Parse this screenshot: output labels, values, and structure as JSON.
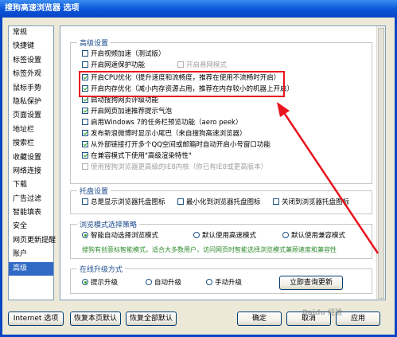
{
  "window": {
    "title": "搜狗高速浏览器 选项"
  },
  "sidebar": {
    "items": [
      {
        "label": "常规"
      },
      {
        "label": "快捷键"
      },
      {
        "label": "标签设置"
      },
      {
        "label": "标签外观"
      },
      {
        "label": "鼠标手势"
      },
      {
        "label": "隐私保护"
      },
      {
        "label": "页面设置"
      },
      {
        "label": "地址栏"
      },
      {
        "label": "搜索栏"
      },
      {
        "label": "收藏设置"
      },
      {
        "label": "网络连接"
      },
      {
        "label": "下载"
      },
      {
        "label": "广告过滤"
      },
      {
        "label": "智能填表"
      },
      {
        "label": "安全"
      },
      {
        "label": "网页更新提醒"
      },
      {
        "label": "账户"
      },
      {
        "label": "高级"
      }
    ],
    "selected": "高级"
  },
  "advanced": {
    "title": "高级设置",
    "options": [
      {
        "label": "开启视频加速（测试版）",
        "checked": false
      },
      {
        "label": "开启网速保护功能",
        "checked": false
      },
      {
        "label": "开启CPU优化（提升速度和流畅度，推荐在使用不流畅时开启）",
        "checked": true
      },
      {
        "label": "开启内存优化（减小内存资源占用，推荐在内存较小的机器上开启）",
        "checked": true
      },
      {
        "label": "启动搜狗网页评级功能",
        "checked": true
      },
      {
        "label": "开启网页加速推荐提示气泡",
        "checked": true
      },
      {
        "label": "启用Windows 7的任务栏预览功能（aero peek）",
        "checked": false
      },
      {
        "label": "发布新浪微博时显示小尾巴（来自搜狗高速浏览器）",
        "checked": true
      },
      {
        "label": "从外部链接打开多个QQ空间或邮箱时自动开启小号窗口功能",
        "checked": true
      },
      {
        "label": "在兼容模式下使用\"高级渲染特性\"",
        "checked": true
      },
      {
        "label": "使用搜狗浏览器更高级的IE8内核（你已有IE8或更高版本）",
        "checked": false,
        "disabled": true
      }
    ],
    "extra_option": {
      "label": "开启悬网模式",
      "checked": false,
      "disabled": true
    }
  },
  "tray": {
    "title": "托盘设置",
    "options": [
      {
        "label": "总是显示浏览器托盘图标",
        "checked": false
      },
      {
        "label": "最小化到浏览器托盘图标",
        "checked": false
      },
      {
        "label": "关闭到浏览器托盘图标",
        "checked": false
      }
    ]
  },
  "mode": {
    "title": "浏览模式选择策略",
    "options": [
      {
        "label": "智能自动选择浏览模式",
        "selected": true
      },
      {
        "label": "默认使用高速模式",
        "selected": false
      },
      {
        "label": "默认使用兼容模式",
        "selected": false
      }
    ],
    "hint": "搜狗有创意标智能模式，适合大多数用户，访问网页时智能选择浏览模式兼顾速度和兼容性"
  },
  "upgrade": {
    "title": "在线升级方式",
    "options": [
      {
        "label": "提示升级",
        "selected": true
      },
      {
        "label": "自动升级",
        "selected": false
      },
      {
        "label": "手动升级",
        "selected": false
      }
    ],
    "check_button": "立即查询更新"
  },
  "footer": {
    "internet_options": "Internet 选项",
    "restore_page": "恢复本页默认",
    "restore_all": "恢复全部默认",
    "ok": "确定",
    "cancel": "取消",
    "apply": "应用"
  },
  "watermark": "Baidu 经验"
}
